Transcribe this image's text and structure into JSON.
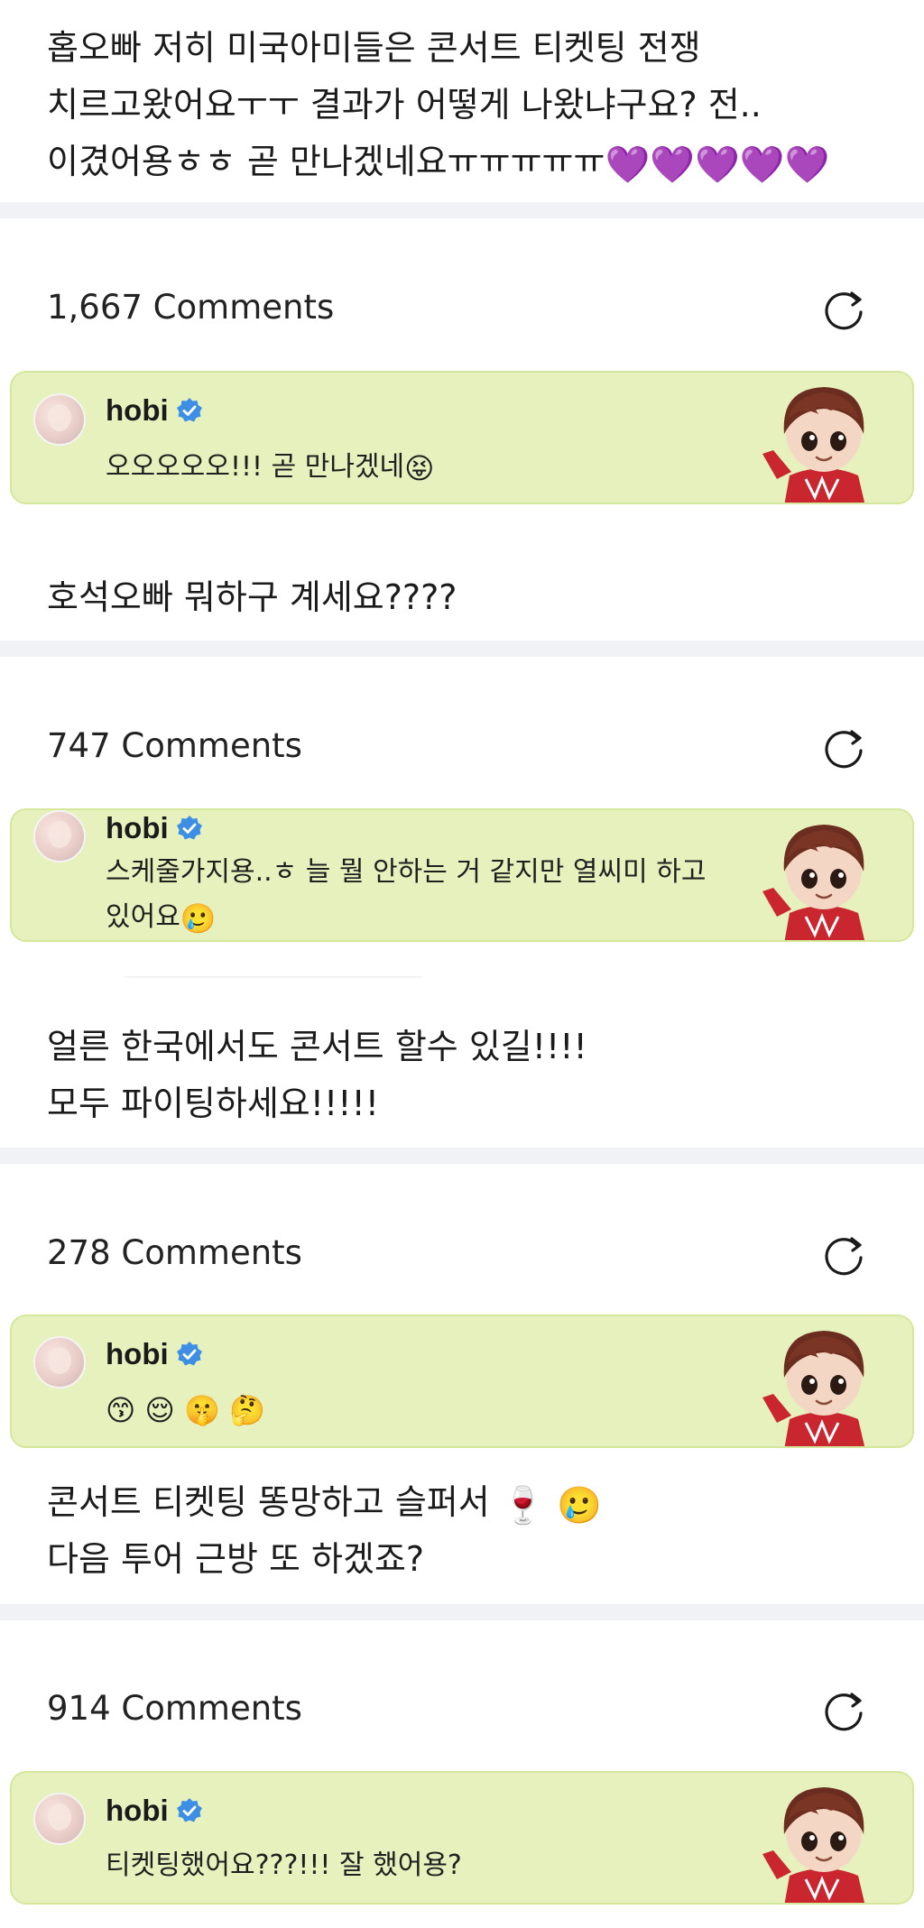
{
  "posts": [
    {
      "fan_text": "홉오빠 저히 미국아미들은 콘서트 티켓팅 전쟁 치르고왔어요ㅜㅜ 결과가 어떻게 나왔냐구요? 전.. 이겼어용ㅎㅎ 곧 만나겠네요ㅠㅠㅠㅠㅠ",
      "fan_emojis": "💜💜💜💜💜",
      "comment_count": "1,667 Comments",
      "reply": {
        "author": "hobi",
        "text": "오오오오오!!! 곧 만나겠네",
        "emojis": "😝"
      }
    },
    {
      "fan_text": "호석오빠 뭐하구 계세요????",
      "fan_emojis": "",
      "comment_count": "747 Comments",
      "reply": {
        "author": "hobi",
        "text": "스케줄가지용..ㅎ 늘 뭘 안하는 거 같지만 열씨미 하고 있어요",
        "emojis": "🥲"
      }
    },
    {
      "fan_text": "얼른 한국에서도 콘서트 할수 있길!!!!\n모두 파이팅하세요!!!!!",
      "fan_emojis": "",
      "comment_count": "278 Comments",
      "reply": {
        "author": "hobi",
        "text": "",
        "emojis": "😙 😌 🤫 🤔"
      }
    },
    {
      "fan_text": "콘서트 티켓팅 똥망하고 슬퍼서 ",
      "fan_text_2": "다음 투어 근방 또 하겠죠?",
      "fan_emojis": "🍷 🥲",
      "comment_count": "914 Comments",
      "reply": {
        "author": "hobi",
        "text": "티켓팅했어요???!!! 잘 했어용?",
        "emojis": ""
      }
    }
  ],
  "colors": {
    "card_bg": "#e7f1be",
    "card_border": "#d5e79b",
    "verified": "#3d8fe6",
    "divider": "#f1f2f6"
  },
  "icons": [
    "refresh-icon",
    "verified-badge-icon",
    "avatar",
    "character-sticker"
  ]
}
